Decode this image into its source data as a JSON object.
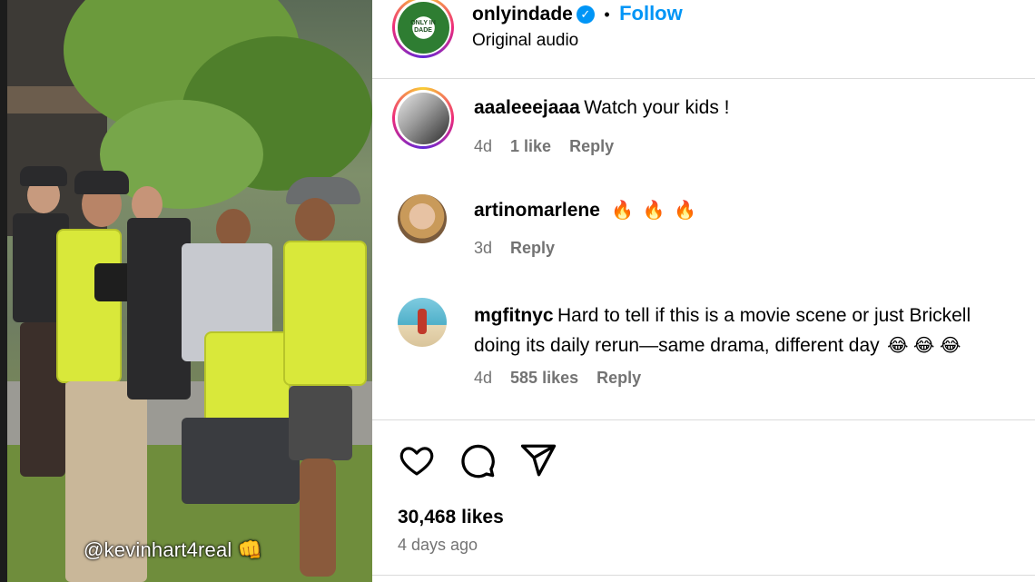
{
  "media": {
    "overlay_tag": "@kevinhart4real",
    "overlay_emoji": "👊"
  },
  "post_header": {
    "username": "onlyindade",
    "separator": "•",
    "follow_label": "Follow",
    "audio_label": "Original audio",
    "avatar_text": "ONLY IN DADE"
  },
  "comments": [
    {
      "username": "aaaleeejaaa",
      "text": "Watch your kids !",
      "age": "4d",
      "likes": "1 like",
      "reply_label": "Reply"
    },
    {
      "username": "artinomarlene",
      "text": "🔥 🔥 🔥",
      "age": "3d",
      "likes": "",
      "reply_label": "Reply"
    },
    {
      "username": "mgfitnyc",
      "text_line1": "Hard to tell if this is a movie scene or just Brickell",
      "text_line2": "doing its daily rerun—same drama, different day",
      "emojis": "😂 😂 😂",
      "age": "4d",
      "likes": "585 likes",
      "reply_label": "Reply"
    }
  ],
  "actions": {
    "like_icon": "heart-outline",
    "comment_icon": "speech-bubble",
    "share_icon": "paper-plane"
  },
  "post_stats": {
    "likes": "30,468 likes",
    "date": "4 days ago"
  },
  "colors": {
    "accent": "#0095f6",
    "secondary_text": "#737373",
    "divider": "#dbdbdb",
    "vest": "#d9e83a"
  }
}
